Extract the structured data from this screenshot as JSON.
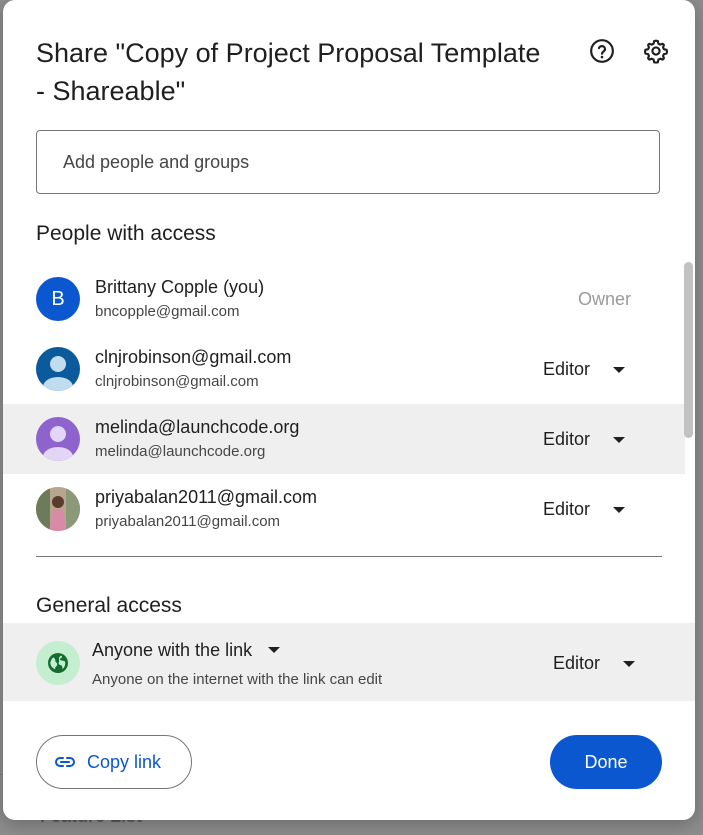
{
  "background_doc": {
    "text": "Feature List"
  },
  "dialog": {
    "title": "Share \"Copy of Project Proposal Template - Shareable\"",
    "add_people_placeholder": "Add people and groups",
    "people_heading": "People with access",
    "people": [
      {
        "avatar_letter": "B",
        "avatar_color": "#0b57d0",
        "name": "Brittany Copple (you)",
        "email": "bncopple@gmail.com",
        "role": "Owner",
        "role_editable": false
      },
      {
        "avatar_color": "#0b5a9c",
        "name": "clnjrobinson@gmail.com",
        "email": "clnjrobinson@gmail.com",
        "role": "Editor",
        "role_editable": true
      },
      {
        "avatar_color": "#8e63ce",
        "name": "melinda@launchcode.org",
        "email": "melinda@launchcode.org",
        "role": "Editor",
        "role_editable": true
      },
      {
        "avatar_kind": "photo",
        "name": "priyabalan2011@gmail.com",
        "email": "priyabalan2011@gmail.com",
        "role": "Editor",
        "role_editable": true
      }
    ],
    "general_heading": "General access",
    "general_access": {
      "icon": "globe-icon",
      "label": "Anyone with the link",
      "description": "Anyone on the internet with the link can edit",
      "role": "Editor"
    },
    "copy_link_label": "Copy link",
    "done_label": "Done"
  },
  "colors": {
    "accent": "#0b57d0",
    "globe_bg": "#c4eed0",
    "globe_fg": "#146c2e",
    "row_highlight": "#efefef"
  }
}
